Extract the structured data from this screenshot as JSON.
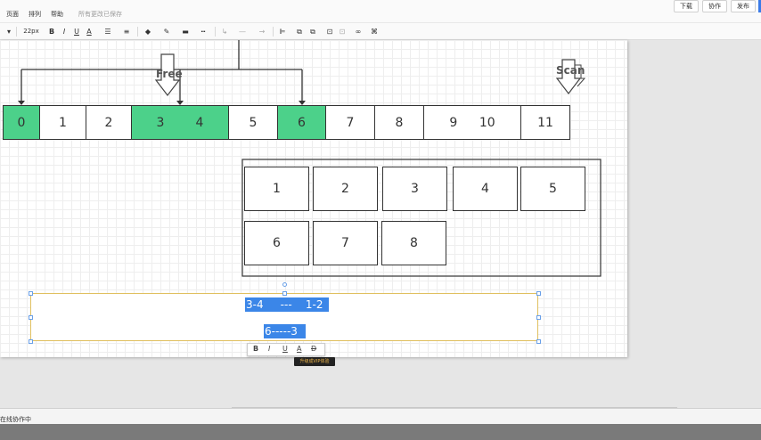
{
  "menu": {
    "items": [
      "页面",
      "排列",
      "帮助"
    ],
    "save_status": "所有更改已保存"
  },
  "top_buttons": {
    "download": "下载",
    "collaborate": "协作",
    "publish": "发布"
  },
  "toolbar": {
    "font_size": "22px",
    "bold": "B",
    "italic": "I",
    "underline": "U",
    "font_color": "A"
  },
  "diagram": {
    "label_free": "Free",
    "label_scan": "Scan",
    "cells": [
      "0",
      "1",
      "2",
      "3",
      "4",
      "5",
      "6",
      "7",
      "8",
      "9",
      "10",
      "11"
    ],
    "highlighted_cells": [
      "0",
      "3",
      "4",
      "6"
    ],
    "boxes_row1": [
      "1",
      "2",
      "3",
      "4",
      "5"
    ],
    "boxes_row2": [
      "6",
      "7",
      "8"
    ],
    "selected_text_line1": "3-4     ---    1-2",
    "selected_text_line2": "6-----3"
  },
  "format_bar": {
    "bold": "B",
    "italic": "I",
    "underline": "U",
    "font_color": "A",
    "clear_format": "D"
  },
  "tooltip": "升级成VIP体验",
  "status_bar": {
    "text": "在线协作中"
  },
  "colors": {
    "green_cell": "#4cd18a",
    "selection_highlight": "#3b86e8",
    "accent_button": "#3b7be8"
  }
}
